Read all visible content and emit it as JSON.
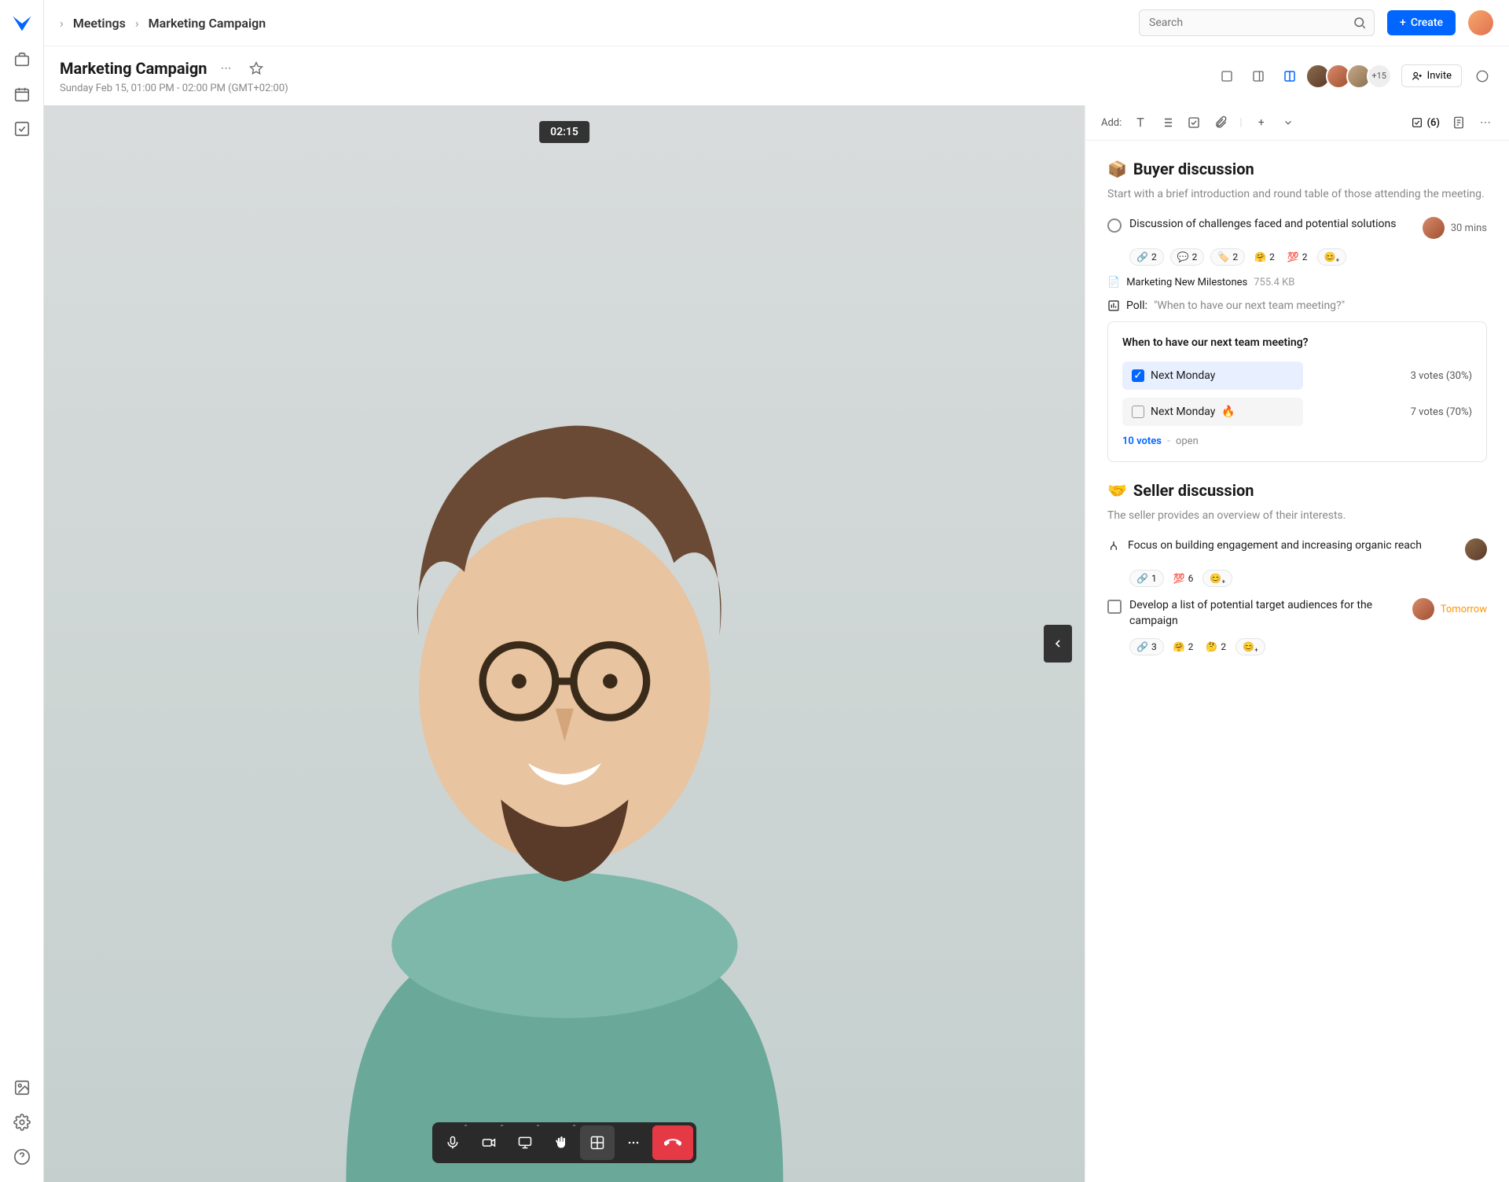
{
  "breadcrumb": {
    "item1": "Meetings",
    "item2": "Marketing Campaign"
  },
  "search": {
    "placeholder": "Search"
  },
  "create": {
    "label": "Create"
  },
  "page": {
    "title": "Marketing Campaign",
    "subtitle": "Sunday Feb 15, 01:00 PM - 02:00 PM (GMT+02:00)"
  },
  "participants": {
    "more": "+15"
  },
  "invite": {
    "label": "Invite"
  },
  "timer": "02:15",
  "toolbar": {
    "add_label": "Add:",
    "tasks_count": "(6)"
  },
  "buyer": {
    "emoji": "📦",
    "title": "Buyer discussion",
    "desc": "Start with a brief introduction and round table of those attending the meeting.",
    "item1": "Discussion of challenges faced and potential solutions",
    "duration": "30 mins",
    "react_link": "2",
    "react_comment": "2",
    "react_tag": "2",
    "react_hug": "2",
    "react_100": "2",
    "attach_name": "Marketing New Milestones",
    "attach_size": "755.4 KB",
    "poll_label": "Poll:",
    "poll_q": "\"When to have our next team meeting?\""
  },
  "poll": {
    "title": "When to have our next team meeting?",
    "opt1": "Next Monday",
    "opt1_result": "3 votes (30%)",
    "opt2": "Next Monday",
    "opt2_result": "7 votes (70%)",
    "total": "10 votes",
    "status": "open"
  },
  "seller": {
    "emoji": "🤝",
    "title": "Seller discussion",
    "desc": "The seller provides an overview of their interests.",
    "item1": "Focus on building engagement and increasing organic reach",
    "r1_link": "1",
    "r1_100": "6",
    "item2": "Develop a list of potential target audiences for the campaign",
    "due2": "Tomorrow",
    "r2_link": "3",
    "r2_hug": "2",
    "r2_think": "2"
  }
}
